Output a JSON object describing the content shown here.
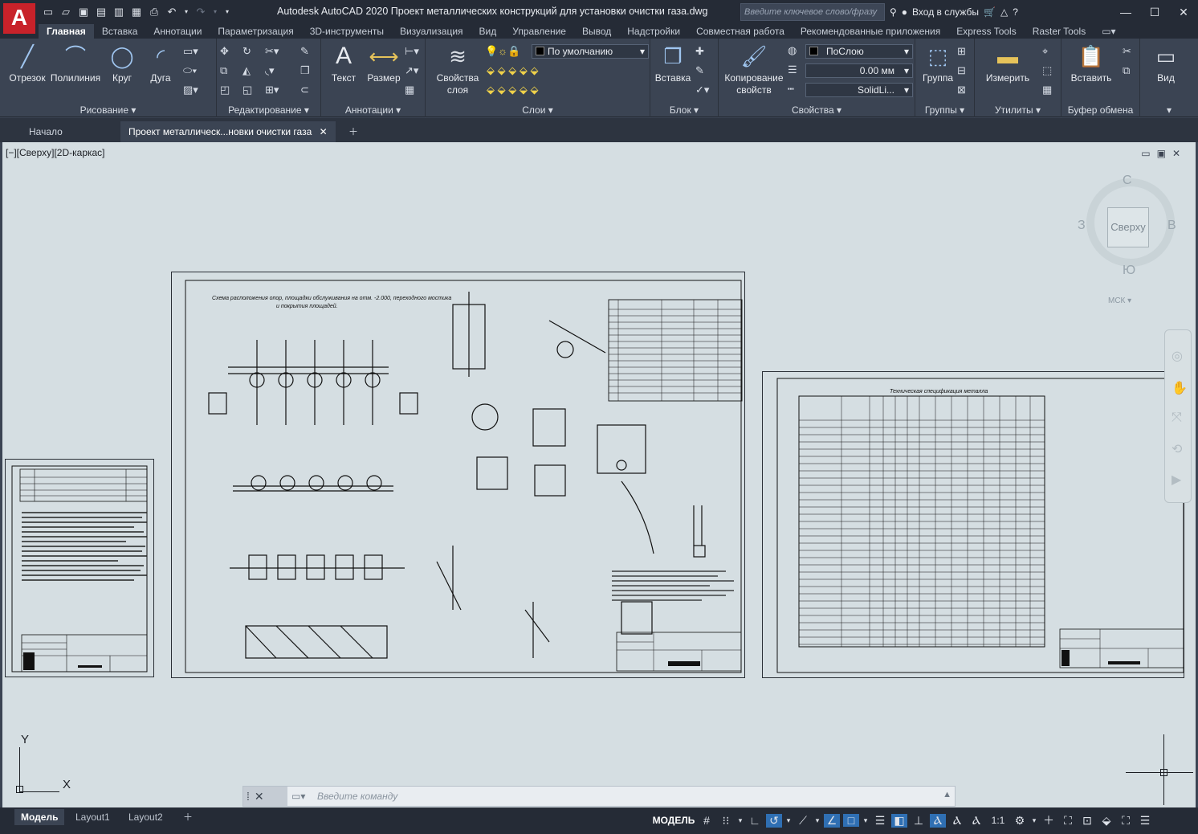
{
  "app": {
    "logo": "A",
    "title": "Autodesk AutoCAD 2020   Проект металлических конструкций для установки очистки газа.dwg",
    "search_placeholder": "Введите ключевое слово/фразу",
    "signin": "Вход в службы"
  },
  "ribbon_tabs": [
    "Главная",
    "Вставка",
    "Аннотации",
    "Параметризация",
    "3D-инструменты",
    "Визуализация",
    "Вид",
    "Управление",
    "Вывод",
    "Надстройки",
    "Совместная работа",
    "Рекомендованные приложения",
    "Express Tools",
    "Raster Tools"
  ],
  "panels": {
    "draw": {
      "title": "Рисование",
      "tools": [
        "Отрезок",
        "Полилиния",
        "Круг",
        "Дуга"
      ]
    },
    "modify": {
      "title": "Редактирование"
    },
    "annotation": {
      "title": "Аннотации",
      "tools": [
        "Текст",
        "Размер"
      ]
    },
    "layers": {
      "title": "Слои",
      "tool": "Свойства слоя",
      "current_layer": "По умолчанию"
    },
    "block": {
      "title": "Блок",
      "tool": "Вставка"
    },
    "properties": {
      "title": "Свойства",
      "tool": "Копирование свойств",
      "color": "ПоСлою",
      "lineweight": "0.00 мм",
      "linetype": "SolidLi..."
    },
    "groups": {
      "title": "Группы",
      "tool": "Группа"
    },
    "utilities": {
      "title": "Утилиты",
      "tool": "Измерить"
    },
    "clipboard": {
      "title": "Буфер обмена",
      "tool": "Вставить"
    },
    "view": {
      "tool": "Вид"
    }
  },
  "file_tabs": {
    "start": "Начало",
    "active": "Проект металлическ...новки очистки газа"
  },
  "viewport": {
    "label": "[−][Сверху][2D-каркас]"
  },
  "viewcube": {
    "face": "Сверху",
    "north": "С",
    "south": "Ю",
    "west": "З",
    "east": "В",
    "wcs": "МСК"
  },
  "ucs": {
    "x": "X",
    "y": "Y"
  },
  "command": {
    "placeholder": "Введите команду"
  },
  "layout_tabs": [
    "Модель",
    "Layout1",
    "Layout2"
  ],
  "status": {
    "model": "МОДЕЛЬ",
    "scale": "1:1"
  },
  "drawings": {
    "sheet1_title": "Схема расположения опор, плоскость обслуживания на отм. −2.000, переходного мостика и покрытия площадей.",
    "sheet3_title": "Техническая спецификация металла"
  }
}
